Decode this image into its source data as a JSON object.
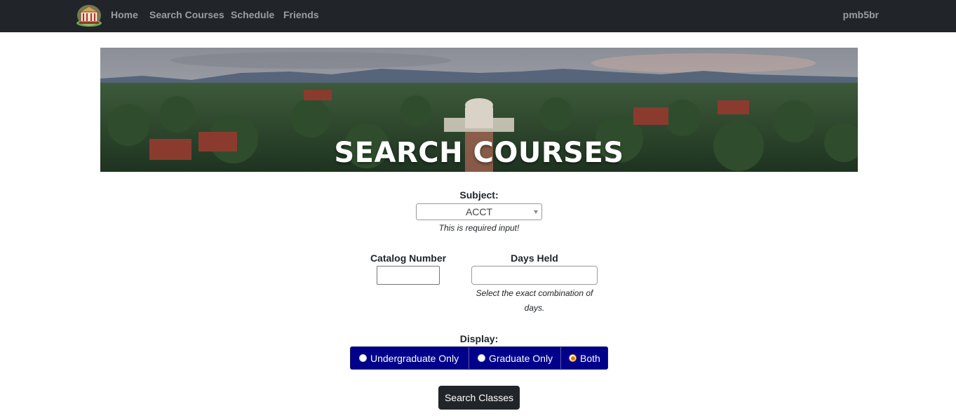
{
  "navbar": {
    "logo_icon": "rotunda-logo-icon",
    "links": [
      {
        "label": "Home"
      },
      {
        "label": "Search Courses"
      },
      {
        "label": "Schedule"
      },
      {
        "label": "Friends"
      }
    ],
    "user": "pmb5br"
  },
  "banner": {
    "title": "SEARCH COURSES"
  },
  "form": {
    "subject": {
      "label": "Subject:",
      "selected": "ACCT",
      "help": "This is required input!"
    },
    "catalog": {
      "label": "Catalog Number",
      "value": ""
    },
    "days": {
      "label": "Days Held",
      "value": "",
      "help": "Select the exact combination of days."
    },
    "display": {
      "label": "Display:",
      "options": [
        {
          "label": "Undergraduate Only",
          "checked": false
        },
        {
          "label": "Graduate Only",
          "checked": false
        },
        {
          "label": "Both",
          "checked": true
        }
      ]
    },
    "submit_label": "Search Classes"
  },
  "colors": {
    "navbar_bg": "#212529",
    "nav_link": "#9a9da1",
    "radio_group_bg": "#00008b",
    "radio_checked": "#e07800",
    "button_bg": "#212529"
  }
}
